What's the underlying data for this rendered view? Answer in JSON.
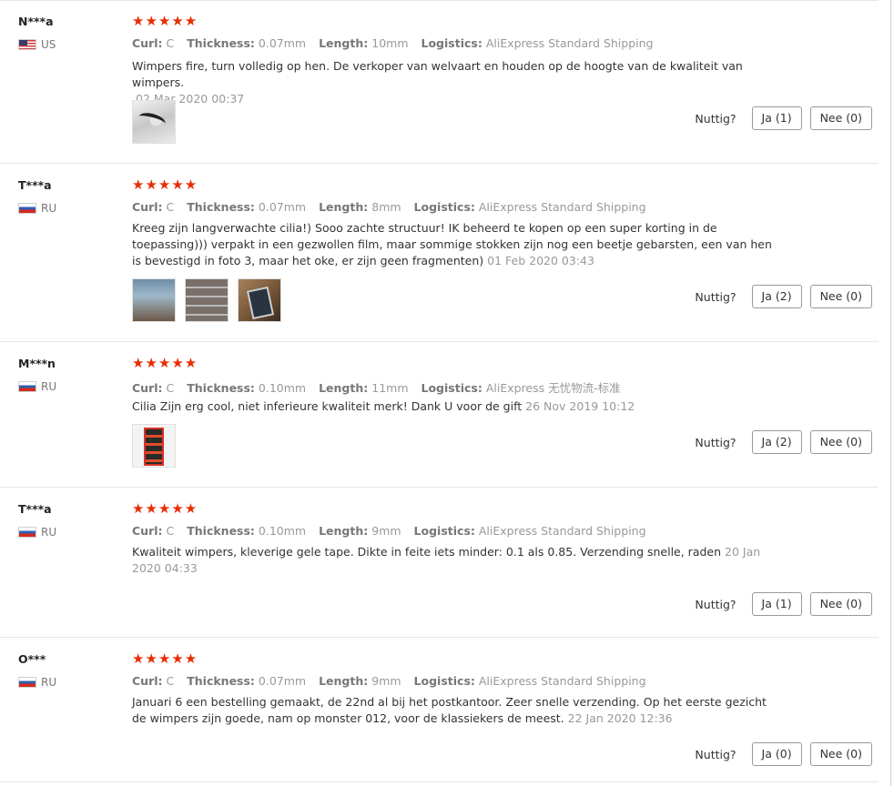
{
  "labels": {
    "curl": "Curl:",
    "thickness": "Thickness:",
    "length": "Length:",
    "logistics": "Logistics:",
    "useful": "Nuttig?"
  },
  "reviews": [
    {
      "user": "N***a",
      "country": "US",
      "stars": "★★★★★",
      "curl": "C",
      "thickness": "0.07mm",
      "length": "10mm",
      "logistics": "AliExpress Standard Shipping",
      "text": "Wimpers fire, turn volledig op hen. De verkoper van welvaart en houden op de hoogte van de kwaliteit van wimpers.",
      "date": "02 Mar 2020 00:37",
      "yes": "Ja (1)",
      "no": "Nee (0)"
    },
    {
      "user": "T***a",
      "country": "RU",
      "stars": "★★★★★",
      "curl": "C",
      "thickness": "0.07mm",
      "length": "8mm",
      "logistics": "AliExpress Standard Shipping",
      "text": "Kreeg zijn langverwachte cilia!) Sooo zachte structuur! IK beheerd te kopen op een super korting in de toepassing))) verpakt in een gezwollen film, maar sommige stokken zijn nog een beetje gebarsten, een van hen is bevestigd in foto 3, maar het oke, er zijn geen fragmenten)",
      "date": "01 Feb 2020 03:43",
      "yes": "Ja (2)",
      "no": "Nee (0)"
    },
    {
      "user": "M***n",
      "country": "RU",
      "stars": "★★★★★",
      "curl": "C",
      "thickness": "0.10mm",
      "length": "11mm",
      "logistics": "AliExpress 无忧物流-标准",
      "text": "Cilia Zijn erg cool, niet inferieure kwaliteit merk! Dank U voor de gift",
      "date": "26 Nov 2019 10:12",
      "yes": "Ja (2)",
      "no": "Nee (0)"
    },
    {
      "user": "T***a",
      "country": "RU",
      "stars": "★★★★★",
      "curl": "C",
      "thickness": "0.10mm",
      "length": "9mm",
      "logistics": "AliExpress Standard Shipping",
      "text": "Kwaliteit wimpers, kleverige gele tape. Dikte in feite iets minder: 0.1 als 0.85. Verzending snelle, raden",
      "date": "20 Jan 2020 04:33",
      "yes": "Ja (1)",
      "no": "Nee (0)"
    },
    {
      "user": "O***",
      "country": "RU",
      "stars": "★★★★★",
      "curl": "C",
      "thickness": "0.07mm",
      "length": "9mm",
      "logistics": "AliExpress Standard Shipping",
      "text": "Januari 6 een bestelling gemaakt, de 22nd al bij het postkantoor. Zeer snelle verzending. Op het eerste gezicht de wimpers zijn goede, nam op monster 012, voor de klassiekers de meest.",
      "date": "22 Jan 2020 12:36",
      "yes": "Ja (0)",
      "no": "Nee (0)"
    }
  ]
}
